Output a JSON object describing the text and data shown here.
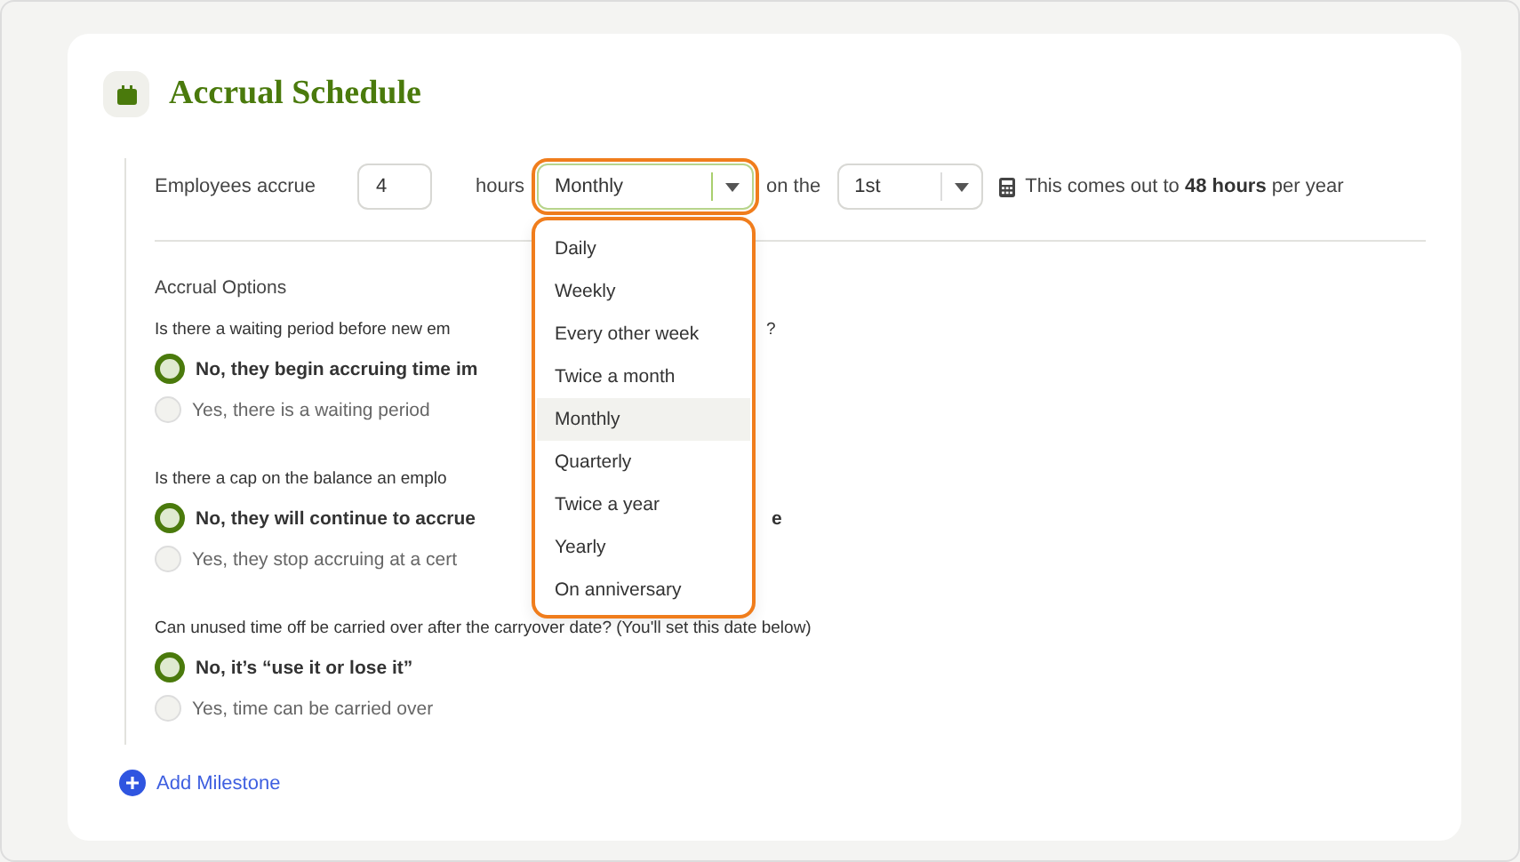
{
  "header": {
    "title": "Accrual Schedule"
  },
  "accrual": {
    "label": "Employees accrue",
    "amount": "4",
    "unit": "hours",
    "frequency": {
      "value": "Monthly",
      "open": true,
      "options": [
        {
          "label": "Daily",
          "selected": false
        },
        {
          "label": "Weekly",
          "selected": false
        },
        {
          "label": "Every other week",
          "selected": false
        },
        {
          "label": "Twice a month",
          "selected": false
        },
        {
          "label": "Monthly",
          "selected": true
        },
        {
          "label": "Quarterly",
          "selected": false
        },
        {
          "label": "Twice a year",
          "selected": false
        },
        {
          "label": "Yearly",
          "selected": false
        },
        {
          "label": "On anniversary",
          "selected": false
        }
      ]
    },
    "day_label": "on the",
    "day": {
      "value": "1st"
    },
    "summary": "This comes out to **48 hours** per year"
  },
  "options": {
    "title": "Accrual Options",
    "questions": [
      {
        "text": "Is there a waiting period before new em",
        "text_after": "?",
        "choices": [
          {
            "label": "No, they begin accruing time im",
            "selected": true
          },
          {
            "label": "Yes, there is a waiting period",
            "selected": false
          }
        ]
      },
      {
        "text": "Is there a cap on the balance an emplo",
        "choices": [
          {
            "label": "No, they will continue to accrue",
            "label_after": "e",
            "selected": true
          },
          {
            "label": "Yes, they stop accruing at a cert",
            "selected": false
          }
        ]
      },
      {
        "text": "Can unused time off be carried over after the carryover date? (You'll set this date below)",
        "choices": [
          {
            "label": "No, it’s “use it or lose it”",
            "selected": true
          },
          {
            "label": "Yes, time can be carried over",
            "selected": false
          }
        ]
      }
    ]
  },
  "add_milestone": {
    "label": "Add Milestone"
  }
}
